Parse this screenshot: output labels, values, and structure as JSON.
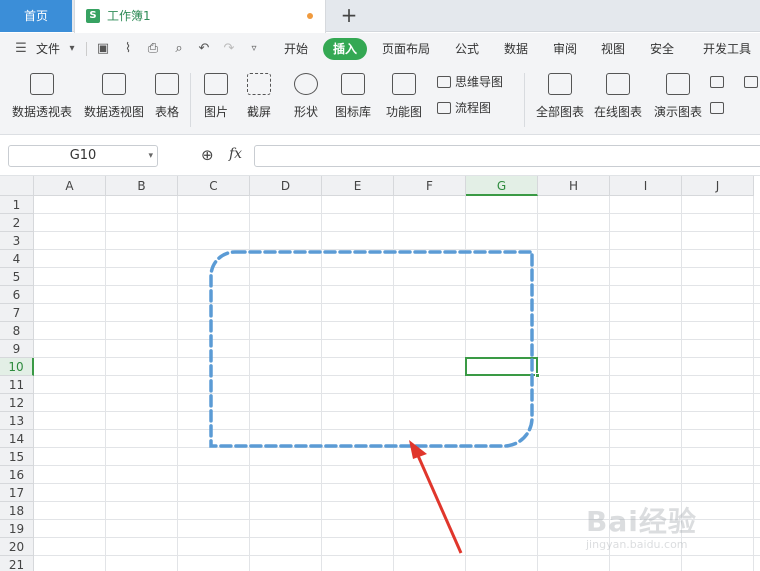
{
  "tabs": {
    "home": "首页",
    "document": "工作簿1",
    "doc_icon": "S",
    "new_tab": "+"
  },
  "menu": {
    "file": "文件",
    "items": [
      "开始",
      "插入",
      "页面布局",
      "公式",
      "数据",
      "审阅",
      "视图",
      "安全",
      "开发工具"
    ],
    "active": "插入"
  },
  "ribbon": {
    "pivot_table": "数据透视表",
    "pivot_chart": "数据透视图",
    "table": "表格",
    "picture": "图片",
    "screenshot": "截屏",
    "shape": "形状",
    "icon_lib": "图标库",
    "function_chart": "功能图",
    "mind_map": "思维导图",
    "flow_chart": "流程图",
    "all_charts": "全部图表",
    "online_chart": "在线图表",
    "demo_chart": "演示图表"
  },
  "formula_bar": {
    "cell_ref": "G10",
    "fx": "fx",
    "formula": ""
  },
  "grid": {
    "columns": [
      "A",
      "B",
      "C",
      "D",
      "E",
      "F",
      "G",
      "H",
      "I",
      "J"
    ],
    "rows": [
      "1",
      "2",
      "3",
      "4",
      "5",
      "6",
      "7",
      "8",
      "9",
      "10",
      "11",
      "12",
      "13",
      "14",
      "15",
      "16",
      "17",
      "18",
      "19",
      "20",
      "21"
    ],
    "active_column": "G",
    "active_row": "10"
  },
  "overlay": {
    "shape": "rounded-rectangle",
    "outline": "dashed",
    "shape_color": "#5b9bd5",
    "arrow_color": "#e0362c"
  },
  "watermark": {
    "brand": "Bai经验",
    "site": "jingyan.baidu.com"
  },
  "colors": {
    "accent_green": "#34a853",
    "home_tab_blue": "#3b8ed8"
  }
}
